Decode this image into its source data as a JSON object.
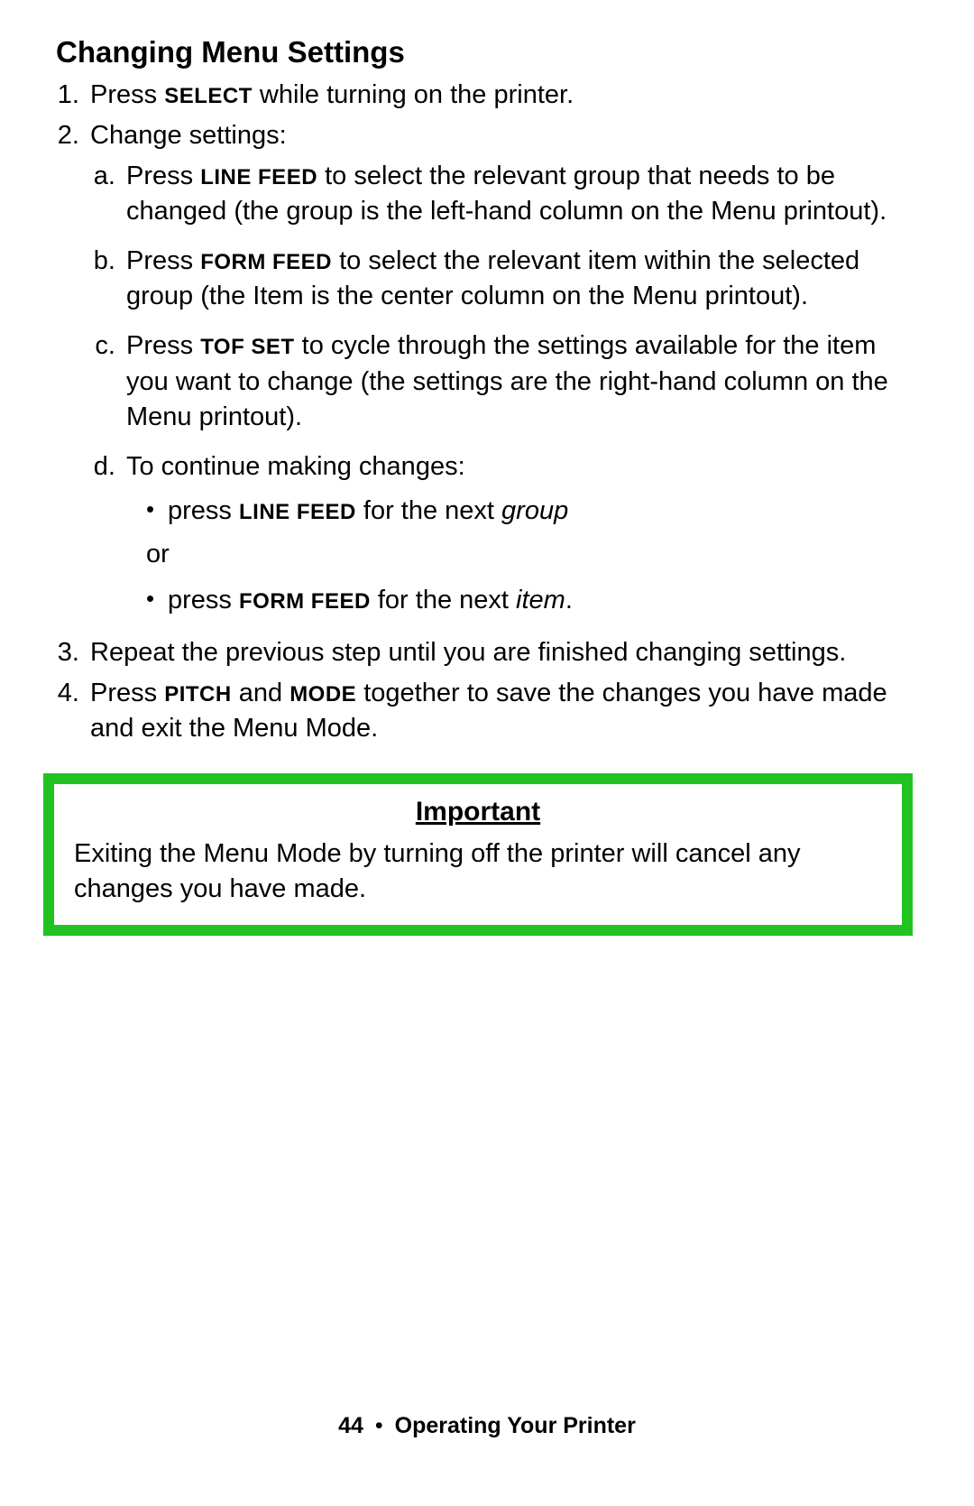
{
  "heading": "Changing Menu Settings",
  "steps": {
    "s1": {
      "pre": "Press ",
      "key": "SELECT",
      "post": " while turning on the printer."
    },
    "s2": {
      "text": "Change settings:"
    },
    "s2a": {
      "pre": "Press ",
      "key": "LINE FEED",
      "post": " to select the relevant group that needs to be changed (the group is the left-hand column on the Menu printout)."
    },
    "s2b": {
      "pre": "Press ",
      "key": "FORM FEED",
      "post": " to select the relevant item within the selected group (the Item is the center column on the Menu printout)."
    },
    "s2c": {
      "pre": "Press ",
      "key": "TOF SET",
      "post": " to cycle through the settings available for the item you want to change (the settings are the right-hand column on the Menu printout)."
    },
    "s2d": {
      "text": "To continue making changes:"
    },
    "s2d_b1": {
      "pre": "press ",
      "key": "LINE FEED",
      "mid": " for the next ",
      "ital": "group"
    },
    "s2d_or": "or",
    "s2d_b2": {
      "pre": "press ",
      "key": "FORM FEED",
      "mid": " for the next ",
      "ital": "item",
      "suffix": "."
    },
    "s3": {
      "text": "Repeat the previous step until you are finished changing settings."
    },
    "s4": {
      "pre": "Press ",
      "key1": "PITCH",
      "mid": " and ",
      "key2": "MODE",
      "post": " together to save the changes you have made and exit the Menu Mode."
    }
  },
  "note": {
    "title": "Important",
    "body": "Exiting the Menu Mode by turning off the printer will cancel any changes you have made."
  },
  "footer": {
    "page": "44",
    "sep": "•",
    "chapter": "Operating Your Printer"
  }
}
